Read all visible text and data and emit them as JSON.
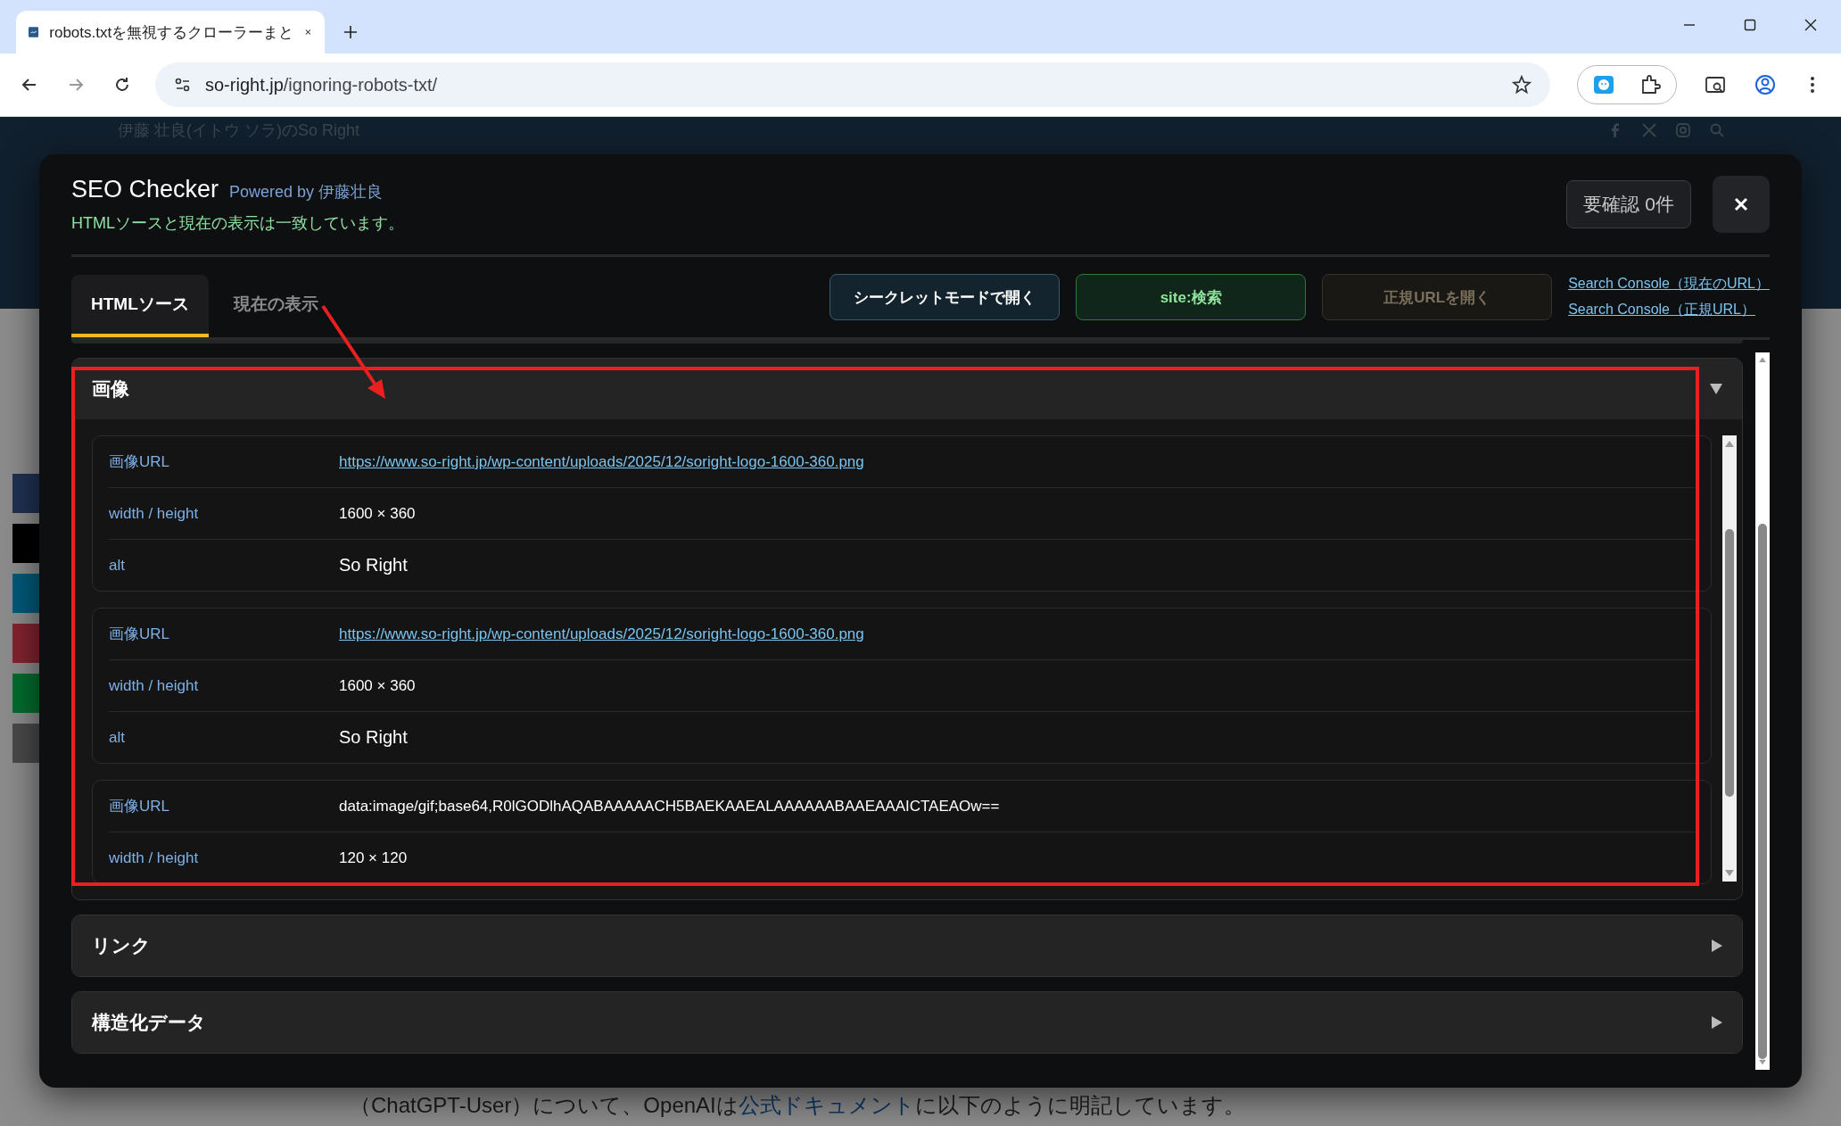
{
  "browser": {
    "tab_title": "robots.txtを無視するクローラーまと",
    "url_host": "so-right.jp",
    "url_path": "/ignoring-robots-txt/"
  },
  "site_header": {
    "author": "伊藤 壮良(イトウ ソラ)のSo Right"
  },
  "page_text": {
    "before": "（ChatGPT-User）について、OpenAIは",
    "link": "公式ドキュメント",
    "after": "に以下のように明記しています。"
  },
  "modal": {
    "title": "SEO Checker",
    "powered_by": "Powered by 伊藤壮良",
    "status": "HTMLソースと現在の表示は一致しています。",
    "review_badge": "要確認 0件",
    "tabs": [
      {
        "label": "HTMLソース",
        "selected": true
      },
      {
        "label": "現在の表示",
        "selected": false
      }
    ],
    "actions": [
      {
        "label": "シークレットモードで開く",
        "kind": "blue"
      },
      {
        "label": "site:検索",
        "kind": "green"
      },
      {
        "label": "正規URLを開く",
        "kind": "muted"
      }
    ],
    "links": [
      "Search Console（現在のURL）",
      "Search Console（正規URL）"
    ],
    "sections": [
      {
        "title": "画像",
        "expanded": true,
        "items": [
          {
            "rows": [
              {
                "label": "画像URL",
                "value": "https://www.so-right.jp/wp-content/uploads/2025/12/soright-logo-1600-360.png",
                "kind": "link"
              },
              {
                "label": "width / height",
                "value": "1600 × 360",
                "kind": "text"
              },
              {
                "label": "alt",
                "value": "So Right",
                "kind": "large"
              }
            ]
          },
          {
            "rows": [
              {
                "label": "画像URL",
                "value": "https://www.so-right.jp/wp-content/uploads/2025/12/soright-logo-1600-360.png",
                "kind": "link"
              },
              {
                "label": "width / height",
                "value": "1600 × 360",
                "kind": "text"
              },
              {
                "label": "alt",
                "value": "So Right",
                "kind": "large"
              }
            ]
          },
          {
            "rows": [
              {
                "label": "画像URL",
                "value": "data:image/gif;base64,R0lGODlhAQABAAAAACH5BAEKAAEALAAAAAABAAEAAAICTAEAOw==",
                "kind": "text"
              },
              {
                "label": "width / height",
                "value": "120 × 120",
                "kind": "text"
              }
            ]
          }
        ]
      },
      {
        "title": "リンク",
        "expanded": false
      },
      {
        "title": "構造化データ",
        "expanded": false
      }
    ]
  }
}
